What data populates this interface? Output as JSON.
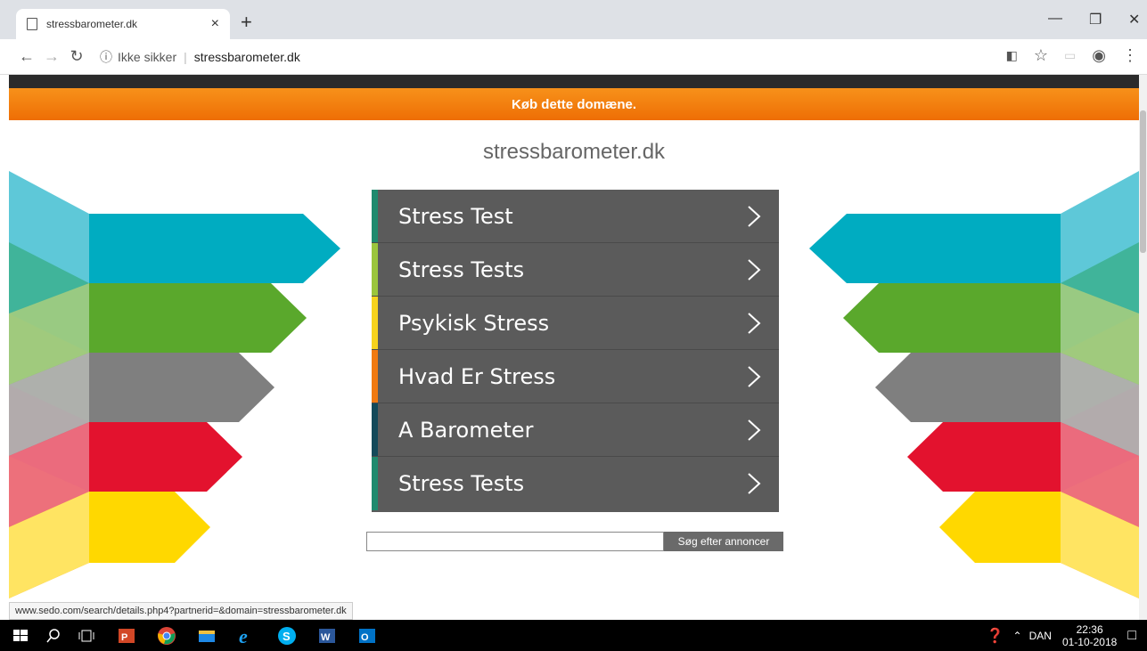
{
  "browser": {
    "tab_title": "stressbarometer.dk",
    "tab_close": "×",
    "new_tab": "+",
    "insecure_label": "Ikke sikker",
    "address": "stressbarometer.dk",
    "status_url": "www.sedo.com/search/details.php4?partnerid=&domain=stressbarometer.dk"
  },
  "page": {
    "banner": "Køb dette domæne.",
    "domain_title": "stressbarometer.dk",
    "links": [
      {
        "label": "Stress Test",
        "color": "#1f8a6e"
      },
      {
        "label": "Stress Tests",
        "color": "#9bc53d"
      },
      {
        "label": "Psykisk Stress",
        "color": "#f7d31e"
      },
      {
        "label": "Hvad Er Stress",
        "color": "#f07a12"
      },
      {
        "label": "A Barometer",
        "color": "#144a5a"
      },
      {
        "label": "Stress Tests",
        "color": "#1f8a6e"
      }
    ],
    "search_placeholder": "",
    "search_button": "Søg efter annoncer"
  },
  "taskbar": {
    "language": "DAN",
    "time": "22:36",
    "date": "01-10-2018"
  },
  "colors": {
    "banner_orange": "#f7911a",
    "arrow_teal": "#00acc1",
    "arrow_green": "#5aa82c",
    "arrow_gray": "#7f7f7f",
    "arrow_red": "#e3122e",
    "arrow_yellow": "#ffd800"
  }
}
